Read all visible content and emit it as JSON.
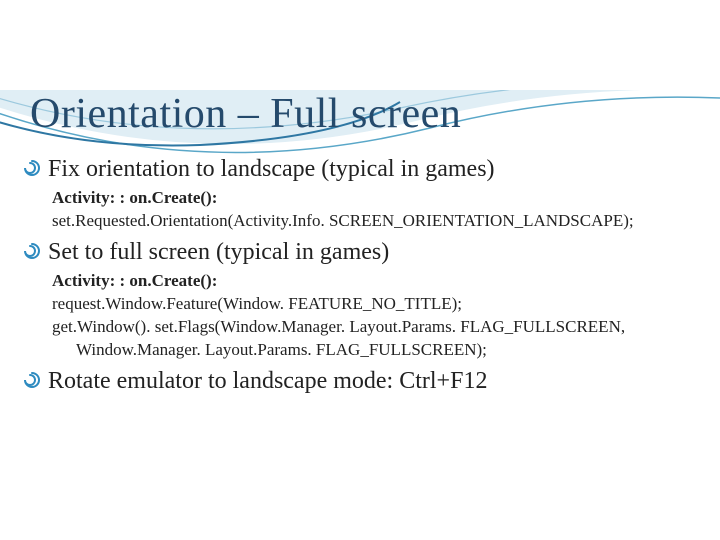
{
  "title": "Orientation – Full screen",
  "bullets": [
    {
      "text": "Fix orientation to landscape (typical in games)",
      "sub": [
        {
          "text": "Activity: : on.Create():",
          "bold": true,
          "indent": false
        },
        {
          "text": "set.Requested.Orientation(Activity.Info. SCREEN_ORIENTATION_LANDSCAPE);",
          "bold": false,
          "indent": false
        }
      ]
    },
    {
      "text": "Set to full screen (typical in games)",
      "sub": [
        {
          "text": "Activity: : on.Create():",
          "bold": true,
          "indent": false
        },
        {
          "text": "request.Window.Feature(Window. FEATURE_NO_TITLE);",
          "bold": false,
          "indent": false
        },
        {
          "text": "get.Window(). set.Flags(Window.Manager. Layout.Params. FLAG_FULLSCREEN,",
          "bold": false,
          "indent": false
        },
        {
          "text": "Window.Manager. Layout.Params. FLAG_FULLSCREEN);",
          "bold": false,
          "indent": true
        }
      ]
    },
    {
      "text": "Rotate emulator to landscape mode: Ctrl+F12",
      "sub": []
    }
  ]
}
